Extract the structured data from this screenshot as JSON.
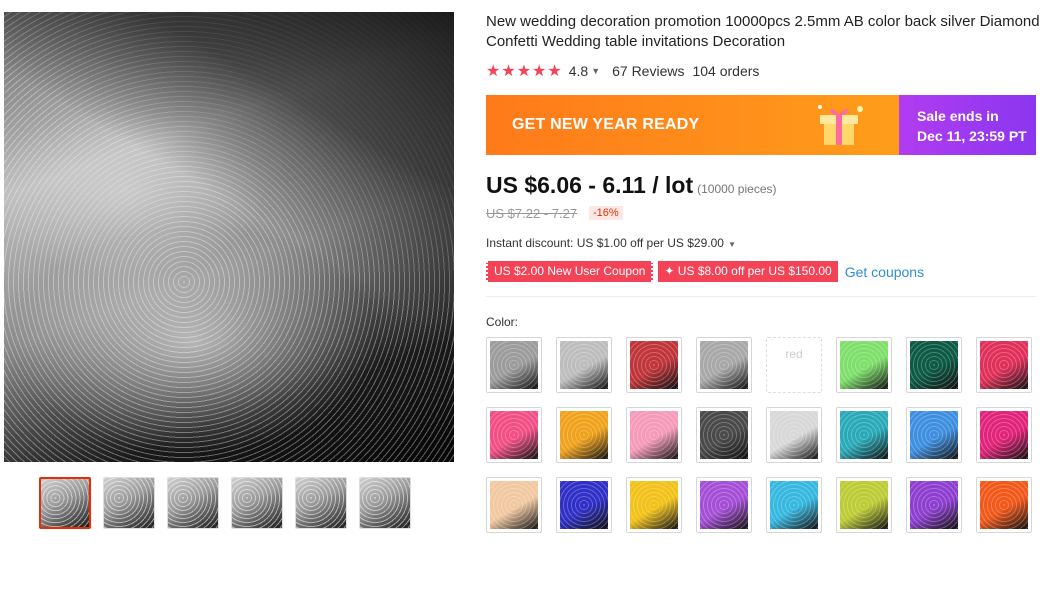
{
  "product": {
    "title": "New wedding decoration promotion 10000pcs 2.5mm AB color back silver Diamond Confetti Wedding table invitations Decoration",
    "stars": "★★★★★",
    "rating": "4.8",
    "reviews": "67 Reviews",
    "orders": "104 orders"
  },
  "banner": {
    "promo": "GET NEW YEAR READY",
    "sale_line1": "Sale ends in",
    "sale_line2": "Dec 11, 23:59 PT"
  },
  "price": {
    "current": "US $6.06 - 6.11 / lot",
    "pieces": "(10000 pieces)",
    "original": "US $7.22 - 7.27",
    "discount": "-16%"
  },
  "instant_discount": "Instant discount: US $1.00 off per US $29.00",
  "coupons": {
    "coupon1": "US $2.00 New User Coupon",
    "coupon2": "✦ US $8.00 off per US $150.00",
    "get_coupons": "Get coupons"
  },
  "color_label": "Color:",
  "swatches": [
    {
      "color": "#9c9c9c"
    },
    {
      "color": "#bdbdbd"
    },
    {
      "color": "#c0353a"
    },
    {
      "color": "#a8a8a8"
    },
    {
      "text": "red"
    },
    {
      "color": "#7ee06a"
    },
    {
      "color": "#0d5a45"
    },
    {
      "color": "#e0305a"
    },
    {
      "color": "#f24f85"
    },
    {
      "color": "#f0a21c"
    },
    {
      "color": "#f59ab8"
    },
    {
      "color": "#4a4a4a"
    },
    {
      "color": "#d8d8d8"
    },
    {
      "color": "#2aaab8"
    },
    {
      "color": "#3f8fe0"
    },
    {
      "color": "#e2237a"
    },
    {
      "color": "#f1c8a0"
    },
    {
      "color": "#3030c8"
    },
    {
      "color": "#f2c21a"
    },
    {
      "color": "#a54fd6"
    },
    {
      "color": "#37b8e0"
    },
    {
      "color": "#bccc35"
    },
    {
      "color": "#8e3fd0"
    },
    {
      "color": "#f2581a"
    }
  ]
}
